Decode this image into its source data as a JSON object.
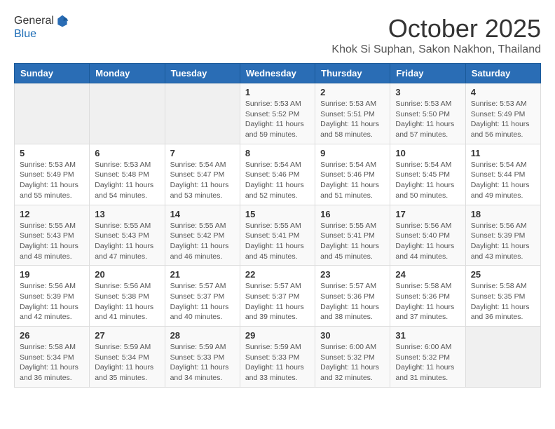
{
  "header": {
    "logo_line1": "General",
    "logo_line2": "Blue",
    "month": "October 2025",
    "location": "Khok Si Suphan, Sakon Nakhon, Thailand"
  },
  "weekdays": [
    "Sunday",
    "Monday",
    "Tuesday",
    "Wednesday",
    "Thursday",
    "Friday",
    "Saturday"
  ],
  "weeks": [
    [
      {
        "day": "",
        "info": ""
      },
      {
        "day": "",
        "info": ""
      },
      {
        "day": "",
        "info": ""
      },
      {
        "day": "1",
        "info": "Sunrise: 5:53 AM\nSunset: 5:52 PM\nDaylight: 11 hours and 59 minutes."
      },
      {
        "day": "2",
        "info": "Sunrise: 5:53 AM\nSunset: 5:51 PM\nDaylight: 11 hours and 58 minutes."
      },
      {
        "day": "3",
        "info": "Sunrise: 5:53 AM\nSunset: 5:50 PM\nDaylight: 11 hours and 57 minutes."
      },
      {
        "day": "4",
        "info": "Sunrise: 5:53 AM\nSunset: 5:49 PM\nDaylight: 11 hours and 56 minutes."
      }
    ],
    [
      {
        "day": "5",
        "info": "Sunrise: 5:53 AM\nSunset: 5:49 PM\nDaylight: 11 hours and 55 minutes."
      },
      {
        "day": "6",
        "info": "Sunrise: 5:53 AM\nSunset: 5:48 PM\nDaylight: 11 hours and 54 minutes."
      },
      {
        "day": "7",
        "info": "Sunrise: 5:54 AM\nSunset: 5:47 PM\nDaylight: 11 hours and 53 minutes."
      },
      {
        "day": "8",
        "info": "Sunrise: 5:54 AM\nSunset: 5:46 PM\nDaylight: 11 hours and 52 minutes."
      },
      {
        "day": "9",
        "info": "Sunrise: 5:54 AM\nSunset: 5:46 PM\nDaylight: 11 hours and 51 minutes."
      },
      {
        "day": "10",
        "info": "Sunrise: 5:54 AM\nSunset: 5:45 PM\nDaylight: 11 hours and 50 minutes."
      },
      {
        "day": "11",
        "info": "Sunrise: 5:54 AM\nSunset: 5:44 PM\nDaylight: 11 hours and 49 minutes."
      }
    ],
    [
      {
        "day": "12",
        "info": "Sunrise: 5:55 AM\nSunset: 5:43 PM\nDaylight: 11 hours and 48 minutes."
      },
      {
        "day": "13",
        "info": "Sunrise: 5:55 AM\nSunset: 5:43 PM\nDaylight: 11 hours and 47 minutes."
      },
      {
        "day": "14",
        "info": "Sunrise: 5:55 AM\nSunset: 5:42 PM\nDaylight: 11 hours and 46 minutes."
      },
      {
        "day": "15",
        "info": "Sunrise: 5:55 AM\nSunset: 5:41 PM\nDaylight: 11 hours and 45 minutes."
      },
      {
        "day": "16",
        "info": "Sunrise: 5:55 AM\nSunset: 5:41 PM\nDaylight: 11 hours and 45 minutes."
      },
      {
        "day": "17",
        "info": "Sunrise: 5:56 AM\nSunset: 5:40 PM\nDaylight: 11 hours and 44 minutes."
      },
      {
        "day": "18",
        "info": "Sunrise: 5:56 AM\nSunset: 5:39 PM\nDaylight: 11 hours and 43 minutes."
      }
    ],
    [
      {
        "day": "19",
        "info": "Sunrise: 5:56 AM\nSunset: 5:39 PM\nDaylight: 11 hours and 42 minutes."
      },
      {
        "day": "20",
        "info": "Sunrise: 5:56 AM\nSunset: 5:38 PM\nDaylight: 11 hours and 41 minutes."
      },
      {
        "day": "21",
        "info": "Sunrise: 5:57 AM\nSunset: 5:37 PM\nDaylight: 11 hours and 40 minutes."
      },
      {
        "day": "22",
        "info": "Sunrise: 5:57 AM\nSunset: 5:37 PM\nDaylight: 11 hours and 39 minutes."
      },
      {
        "day": "23",
        "info": "Sunrise: 5:57 AM\nSunset: 5:36 PM\nDaylight: 11 hours and 38 minutes."
      },
      {
        "day": "24",
        "info": "Sunrise: 5:58 AM\nSunset: 5:36 PM\nDaylight: 11 hours and 37 minutes."
      },
      {
        "day": "25",
        "info": "Sunrise: 5:58 AM\nSunset: 5:35 PM\nDaylight: 11 hours and 36 minutes."
      }
    ],
    [
      {
        "day": "26",
        "info": "Sunrise: 5:58 AM\nSunset: 5:34 PM\nDaylight: 11 hours and 36 minutes."
      },
      {
        "day": "27",
        "info": "Sunrise: 5:59 AM\nSunset: 5:34 PM\nDaylight: 11 hours and 35 minutes."
      },
      {
        "day": "28",
        "info": "Sunrise: 5:59 AM\nSunset: 5:33 PM\nDaylight: 11 hours and 34 minutes."
      },
      {
        "day": "29",
        "info": "Sunrise: 5:59 AM\nSunset: 5:33 PM\nDaylight: 11 hours and 33 minutes."
      },
      {
        "day": "30",
        "info": "Sunrise: 6:00 AM\nSunset: 5:32 PM\nDaylight: 11 hours and 32 minutes."
      },
      {
        "day": "31",
        "info": "Sunrise: 6:00 AM\nSunset: 5:32 PM\nDaylight: 11 hours and 31 minutes."
      },
      {
        "day": "",
        "info": ""
      }
    ]
  ]
}
